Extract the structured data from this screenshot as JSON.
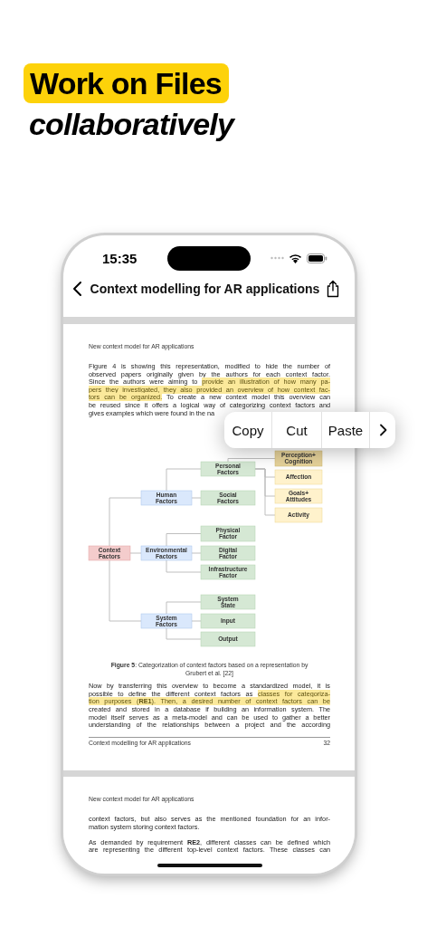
{
  "headline": {
    "badge": "Work on Files",
    "subtitle": "collaboratively"
  },
  "status_bar": {
    "time": "15:35"
  },
  "nav_bar": {
    "title": "Context modelling for AR applications"
  },
  "pages": [
    {
      "running_header": "New context model for AR applications",
      "blocks": [
        {
          "kind": "paragraph",
          "continues": false,
          "lines": [
            [
              {
                "text": "Figure 4 is showing this representation, modified to hide the number of",
                "highlighted": false
              }
            ],
            [
              {
                "text": "observed papers originally given by the authors for each context factor.",
                "highlighted": false
              }
            ],
            [
              {
                "text": "Since the authors were aiming to ",
                "highlighted": false
              },
              {
                "text": "provide an illustration of how many pa-",
                "highlighted": true
              }
            ],
            [
              {
                "text": "pers they investigated, they also provided an overview of how context fac-",
                "highlighted": true
              }
            ],
            [
              {
                "text": "tors can be organized.",
                "highlighted": true
              },
              {
                "text": " To create a new context model this overview can",
                "highlighted": false
              }
            ],
            [
              {
                "text": "be reused since it offers a logical way of categorizing context factors and",
                "highlighted": false
              }
            ],
            [
              {
                "text": "gives examples which were found in the na",
                "highlighted": false
              }
            ]
          ]
        },
        {
          "kind": "diagram",
          "root": {
            "label_lines": [
              "Context",
              "Factors"
            ],
            "kind": "root",
            "highlighted": false,
            "children": [
              {
                "label_lines": [
                  "Human",
                  "Factors"
                ],
                "kind": "group",
                "highlighted": false,
                "children": [
                  {
                    "label_lines": [
                      "Personal",
                      "Factors"
                    ],
                    "kind": "factor",
                    "highlighted": false,
                    "children": [
                      {
                        "label_lines": [
                          "Perception+",
                          "Cognition"
                        ],
                        "kind": "attribute",
                        "highlighted": true
                      },
                      {
                        "label_lines": [
                          "Affection"
                        ],
                        "kind": "attribute",
                        "highlighted": false
                      },
                      {
                        "label_lines": [
                          "Goals+",
                          "Attitudes"
                        ],
                        "kind": "attribute",
                        "highlighted": false
                      },
                      {
                        "label_lines": [
                          "Activity"
                        ],
                        "kind": "attribute",
                        "highlighted": false
                      }
                    ]
                  },
                  {
                    "label_lines": [
                      "Social",
                      "Factors"
                    ],
                    "kind": "factor",
                    "highlighted": false
                  }
                ]
              },
              {
                "label_lines": [
                  "Environmental",
                  "Factors"
                ],
                "kind": "group",
                "highlighted": false,
                "children": [
                  {
                    "label_lines": [
                      "Physical",
                      "Factor"
                    ],
                    "kind": "factor",
                    "highlighted": false
                  },
                  {
                    "label_lines": [
                      "Digital",
                      "Factor"
                    ],
                    "kind": "factor",
                    "highlighted": false
                  },
                  {
                    "label_lines": [
                      "Infrastructure",
                      "Factor"
                    ],
                    "kind": "factor",
                    "highlighted": false
                  }
                ]
              },
              {
                "label_lines": [
                  "System",
                  "Factors"
                ],
                "kind": "group",
                "highlighted": false,
                "children": [
                  {
                    "label_lines": [
                      "System",
                      "State"
                    ],
                    "kind": "factor",
                    "highlighted": false
                  },
                  {
                    "label_lines": [
                      "Input"
                    ],
                    "kind": "factor",
                    "highlighted": false
                  },
                  {
                    "label_lines": [
                      "Output"
                    ],
                    "kind": "factor",
                    "highlighted": false
                  }
                ]
              }
            ]
          }
        },
        {
          "kind": "caption",
          "lines": [
            "**Figure 5**: Categorization of context factors based on a representation by",
            "Grubert et al. [22]"
          ]
        },
        {
          "kind": "paragraph",
          "continues": true,
          "lines": [
            [
              {
                "text": "Now by transferring this overview to become a standardized model, it is",
                "highlighted": false
              }
            ],
            [
              {
                "text": "possible to define the different context factors as ",
                "highlighted": false
              },
              {
                "text": "classes for categoriza-",
                "highlighted": true
              }
            ],
            [
              {
                "text": "tion purposes (**RE1**). Then, a desired number of context factors can be",
                "highlighted": true
              }
            ],
            [
              {
                "text": "created and stored in a database if building an information system. The",
                "highlighted": false
              }
            ],
            [
              {
                "text": "model itself serves as a meta-model and can be used to gather a better",
                "highlighted": false
              }
            ],
            [
              {
                "text": "understanding of the relationships between a project and the according",
                "highlighted": false
              }
            ]
          ]
        }
      ],
      "footer": {
        "title": "Context modelling for AR applications",
        "page_number": "32"
      }
    },
    {
      "running_header": "New context model for AR applications",
      "blocks": [
        {
          "kind": "paragraph",
          "continues": false,
          "lines": [
            [
              {
                "text": "context factors, but also serves as the mentioned foundation for an infor-",
                "highlighted": false
              }
            ],
            [
              {
                "text": "mation system storing context factors.",
                "highlighted": false
              }
            ]
          ]
        },
        {
          "kind": "paragraph",
          "continues": true,
          "lines": [
            [
              {
                "text": "As demanded by requirement **RE2**, different classes can be defined which",
                "highlighted": false
              }
            ],
            [
              {
                "text": "are representing the different top-level context factors. These classes can",
                "highlighted": false
              }
            ]
          ]
        }
      ]
    }
  ],
  "edit_menu": {
    "items": [
      {
        "label": "Copy"
      },
      {
        "label": "Cut"
      },
      {
        "label": "Paste"
      }
    ],
    "more_button": true
  }
}
